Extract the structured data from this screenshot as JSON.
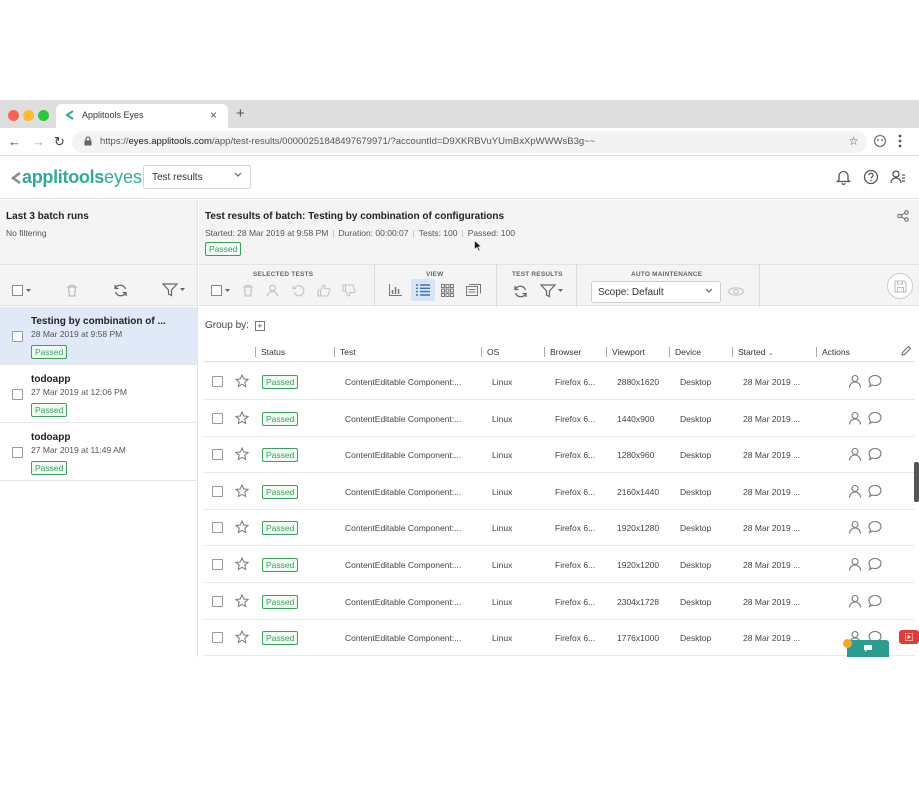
{
  "browser": {
    "tab_title": "Applitools Eyes",
    "url_host": "eyes.applitools.com",
    "url_prefix": "https://",
    "url_path": "/app/test-results/00000251848497679971/?accountId=D9XKRBVuYUmBxXpWWWsB3g~~"
  },
  "header": {
    "logo_brand": "applitools",
    "logo_product": "eyes",
    "page_select": "Test results"
  },
  "left_panel": {
    "title": "Last 3 batch runs",
    "filter": "No filtering",
    "batches": [
      {
        "name": "Testing by combination of ...",
        "date": "28 Mar 2019 at 9:58 PM",
        "status": "Passed",
        "selected": true
      },
      {
        "name": "todoapp",
        "date": "27 Mar 2019 at 12:06 PM",
        "status": "Passed",
        "selected": false
      },
      {
        "name": "todoapp",
        "date": "27 Mar 2019 at 11:49 AM",
        "status": "Passed",
        "selected": false
      }
    ]
  },
  "batch": {
    "title": "Test results of batch: Testing by combination of configurations",
    "started": "Started: 28 Mar 2019 at 9:58 PM",
    "duration": "Duration: 00:00:07",
    "tests": "Tests: 100",
    "passed": "Passed: 100",
    "status": "Passed"
  },
  "toolbar": {
    "selected_tests": "SELECTED TESTS",
    "view": "VIEW",
    "test_results": "TEST RESULTS",
    "auto_maintenance": "AUTO MAINTENANCE",
    "scope": "Scope: Default"
  },
  "group_by": "Group by:",
  "table": {
    "columns": [
      "Status",
      "Test",
      "OS",
      "Browser",
      "Viewport",
      "Device",
      "Started",
      "Actions"
    ],
    "rows": [
      {
        "status": "Passed",
        "test": "ContentEditable Component:...",
        "os": "Linux",
        "browser": "Firefox 6...",
        "viewport": "2880x1620",
        "device": "Desktop",
        "started": "28 Mar 2019 ..."
      },
      {
        "status": "Passed",
        "test": "ContentEditable Component:...",
        "os": "Linux",
        "browser": "Firefox 6...",
        "viewport": "1440x900",
        "device": "Desktop",
        "started": "28 Mar 2019 ..."
      },
      {
        "status": "Passed",
        "test": "ContentEditable Component:...",
        "os": "Linux",
        "browser": "Firefox 6...",
        "viewport": "1280x960",
        "device": "Desktop",
        "started": "28 Mar 2019 ..."
      },
      {
        "status": "Passed",
        "test": "ContentEditable Component:...",
        "os": "Linux",
        "browser": "Firefox 6...",
        "viewport": "2160x1440",
        "device": "Desktop",
        "started": "28 Mar 2019 ..."
      },
      {
        "status": "Passed",
        "test": "ContentEditable Component:...",
        "os": "Linux",
        "browser": "Firefox 6...",
        "viewport": "1920x1280",
        "device": "Desktop",
        "started": "28 Mar 2019 ..."
      },
      {
        "status": "Passed",
        "test": "ContentEditable Component:...",
        "os": "Linux",
        "browser": "Firefox 6...",
        "viewport": "1920x1200",
        "device": "Desktop",
        "started": "28 Mar 2019 ..."
      },
      {
        "status": "Passed",
        "test": "ContentEditable Component:...",
        "os": "Linux",
        "browser": "Firefox 6...",
        "viewport": "2304x1728",
        "device": "Desktop",
        "started": "28 Mar 2019 ..."
      },
      {
        "status": "Passed",
        "test": "ContentEditable Component:...",
        "os": "Linux",
        "browser": "Firefox 6...",
        "viewport": "1776x1000",
        "device": "Desktop",
        "started": "28 Mar 2019 ..."
      }
    ]
  },
  "colors": {
    "brand": "#2dac9a",
    "passed": "#3aa05c",
    "selected_row": "#dfe9f7"
  },
  "icons": {
    "tab": "applitools-favicon",
    "header": [
      "bell-icon",
      "help-icon",
      "account-icon"
    ],
    "row_actions": [
      "user-icon",
      "comment-icon"
    ]
  }
}
